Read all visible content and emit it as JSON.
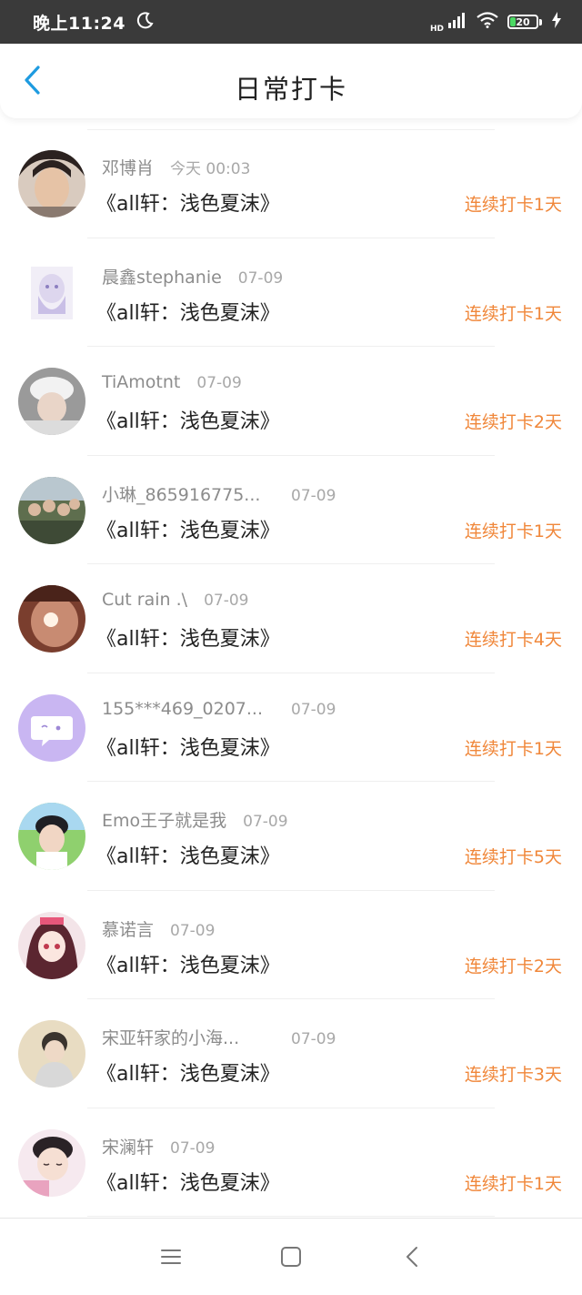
{
  "status_bar": {
    "time": "晚上11:24",
    "network": "HD",
    "battery": "20",
    "battery_fraction": 0.2,
    "icons": [
      "moon-icon",
      "signal-icon",
      "wifi-icon",
      "battery-icon",
      "charging-icon"
    ]
  },
  "header": {
    "title": "日常打卡",
    "back_icon": "chevron-left-icon"
  },
  "colors": {
    "accent": "#1e9be0",
    "streak": "#f0873a",
    "username": "#8c8c8c",
    "timestamp": "#a8a8a8",
    "title_text": "#222222",
    "status_bar_bg": "#3a3a3a"
  },
  "checkins": [
    {
      "username": "邓博肖",
      "time": "今天 00:03",
      "book": "《all轩：浅色夏沫》",
      "streak": "连续打卡1天"
    },
    {
      "username": "晨鑫stephanie",
      "time": "07-09",
      "book": "《all轩：浅色夏沫》",
      "streak": "连续打卡1天"
    },
    {
      "username": "TiAmotnt",
      "time": "07-09",
      "book": "《all轩：浅色夏沫》",
      "streak": "连续打卡2天"
    },
    {
      "username": "小琳_865916775...",
      "time": "07-09",
      "book": "《all轩：浅色夏沫》",
      "streak": "连续打卡1天"
    },
    {
      "username": "Cut rain .\\",
      "time": "07-09",
      "book": "《all轩：浅色夏沫》",
      "streak": "连续打卡4天"
    },
    {
      "username": "155***469_0207...",
      "time": "07-09",
      "book": "《all轩：浅色夏沫》",
      "streak": "连续打卡1天"
    },
    {
      "username": "Emo王子就是我",
      "time": "07-09",
      "book": "《all轩：浅色夏沫》",
      "streak": "连续打卡5天"
    },
    {
      "username": "慕诺言",
      "time": "07-09",
      "book": "《all轩：浅色夏沫》",
      "streak": "连续打卡2天"
    },
    {
      "username": "宋亚轩家的小海...",
      "time": "07-09",
      "book": "《all轩：浅色夏沫》",
      "streak": "连续打卡3天"
    },
    {
      "username": "宋澜轩",
      "time": "07-09",
      "book": "《all轩：浅色夏沫》",
      "streak": "连续打卡1天"
    }
  ],
  "bottom_nav": {
    "icons": [
      "menu-icon",
      "home-square-icon",
      "back-triangle-icon"
    ]
  }
}
